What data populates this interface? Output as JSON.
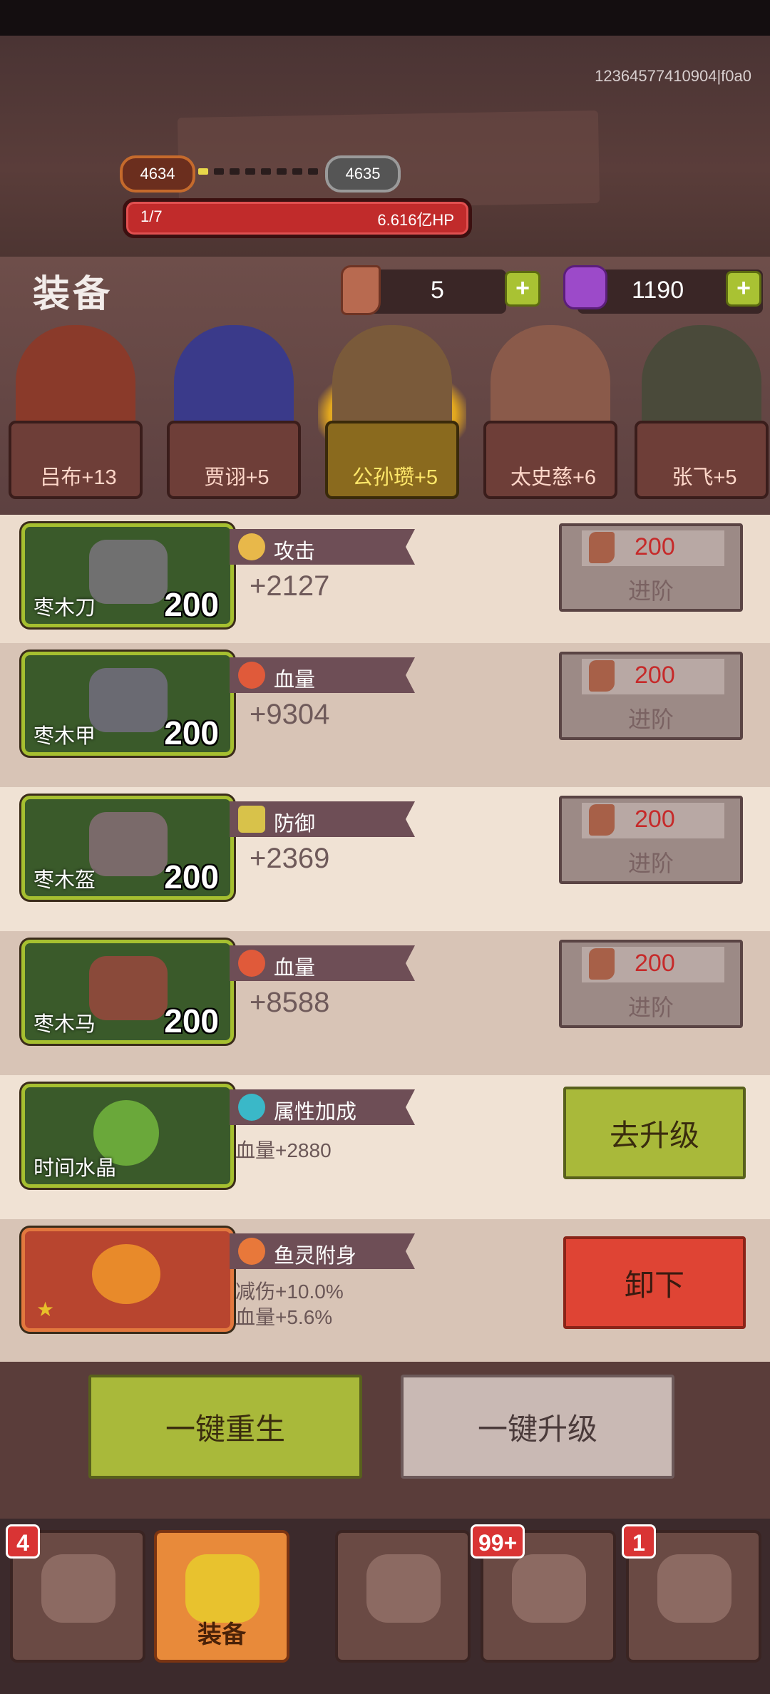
{
  "header": {
    "uid_text": "12364577410904|f0a0",
    "level_current": "4634",
    "level_next": "4635",
    "hp_stage": "1/7",
    "hp_value": "6.616亿HP"
  },
  "panel": {
    "title": "装备",
    "stone_count": "5",
    "gem_count": "1190"
  },
  "heroes": [
    {
      "name": "吕布+13",
      "selected": false
    },
    {
      "name": "贾诩+5",
      "selected": false
    },
    {
      "name": "公孙瓒+5",
      "selected": true
    },
    {
      "name": "太史慈+6",
      "selected": false
    },
    {
      "name": "张飞+5",
      "selected": false
    }
  ],
  "equipment": [
    {
      "item": "枣木刀",
      "level": "200",
      "stat_label": "攻击",
      "stat_value": "+2127",
      "cost": "200",
      "action": "进阶"
    },
    {
      "item": "枣木甲",
      "level": "200",
      "stat_label": "血量",
      "stat_value": "+9304",
      "cost": "200",
      "action": "进阶"
    },
    {
      "item": "枣木盔",
      "level": "200",
      "stat_label": "防御",
      "stat_value": "+2369",
      "cost": "200",
      "action": "进阶"
    },
    {
      "item": "枣木马",
      "level": "200",
      "stat_label": "血量",
      "stat_value": "+8588",
      "cost": "200",
      "action": "进阶"
    }
  ],
  "crystal": {
    "item": "时间水晶",
    "stat_label": "属性加成",
    "stat_value": "血量+2880",
    "button": "去升级"
  },
  "fish": {
    "stat_label": "鱼灵附身",
    "line1": "减伤+10.0%",
    "line2": "血量+5.6%",
    "button": "卸下"
  },
  "footer": {
    "rebirth": "一键重生",
    "upgrade_all": "一键升级"
  },
  "tabs": [
    {
      "label": "",
      "badge": "4"
    },
    {
      "label": "装备",
      "badge": ""
    },
    {
      "label": "",
      "badge": ""
    },
    {
      "label": "",
      "badge": "99+"
    },
    {
      "label": "",
      "badge": "1"
    }
  ],
  "colors": {
    "accent_green": "#a9b93a",
    "accent_red": "#df4434",
    "cost_red": "#c62a2a",
    "hp_red": "#c12b2b"
  }
}
